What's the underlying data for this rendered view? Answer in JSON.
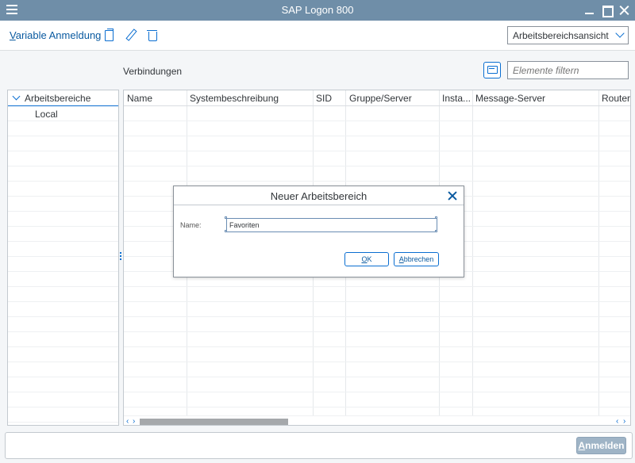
{
  "window": {
    "title": "SAP Logon 800"
  },
  "toolbar": {
    "variable_logon_mnemonic": "V",
    "variable_logon_rest": "ariable Anmeldung",
    "view_select_value": "Arbeitsbereichsansicht"
  },
  "connections": {
    "label": "Verbindungen",
    "filter_placeholder": "Elemente filtern"
  },
  "tree": {
    "header": "Arbeitsbereiche",
    "items": [
      "Local"
    ]
  },
  "table": {
    "columns": [
      "Name",
      "Systembeschreibung",
      "SID",
      "Gruppe/Server",
      "Insta...",
      "Message-Server",
      "Router"
    ],
    "scroll_left": "‹",
    "scroll_right": "›"
  },
  "dialog": {
    "title": "Neuer Arbeitsbereich",
    "name_label": "Name:",
    "name_value": "Favoriten",
    "ok_mnemonic": "O",
    "ok_rest": "K",
    "cancel_mnemonic": "A",
    "cancel_rest": "bbrechen"
  },
  "bottom": {
    "logon_mnemonic": "A",
    "logon_rest": "nmelden"
  },
  "icons": {
    "menu": "hamburger-icon",
    "copy": "copy-icon",
    "edit": "pencil-icon",
    "delete": "trash-icon",
    "chat": "message-icon",
    "close": "close-icon"
  },
  "colors": {
    "titlebar": "#6f8ea8",
    "accent": "#0a6ed1",
    "logon_button": "#9fb4c6"
  }
}
